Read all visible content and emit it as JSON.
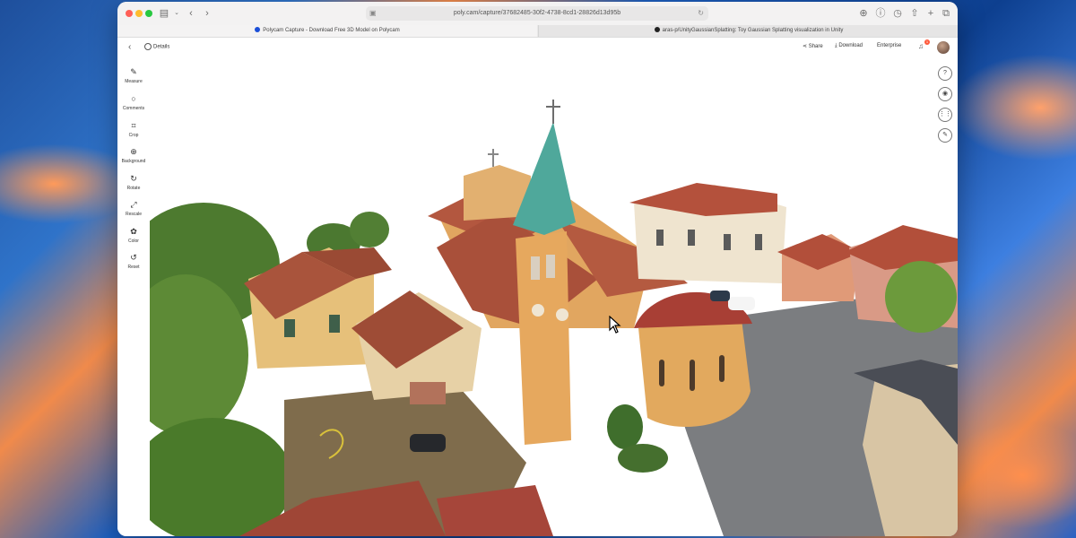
{
  "browser": {
    "url": "poly.cam/capture/37682485-30f2-4738-8cd1-28826d13d95b",
    "tabs": [
      {
        "label": "Polycam Capture - Download Free 3D Model on Polycam",
        "active": true
      },
      {
        "label": "aras-p/UnityGaussianSplatting: Toy Gaussian Splatting visualization in Unity",
        "active": false
      }
    ],
    "icons": [
      "sidebar-icon",
      "chevron-down-icon",
      "back-icon",
      "forward-icon",
      "download-icon",
      "info-icon",
      "history-icon",
      "share-icon",
      "new-tab-icon",
      "tab-overview-icon"
    ]
  },
  "header": {
    "details_label": "Details",
    "share_label": "Share",
    "download_label": "Download",
    "enterprise_label": "Enterprise",
    "notification_count": "1"
  },
  "sidebar": {
    "tools": [
      {
        "label": "Measure",
        "icon": "ruler-icon"
      },
      {
        "label": "Comments",
        "icon": "comment-icon"
      },
      {
        "label": "Crop",
        "icon": "crop-icon"
      },
      {
        "label": "Background",
        "icon": "globe-icon"
      },
      {
        "label": "Rotate",
        "icon": "rotate-icon"
      },
      {
        "label": "Rescale",
        "icon": "rescale-icon"
      },
      {
        "label": "Color",
        "icon": "color-icon"
      },
      {
        "label": "Reset",
        "icon": "reset-icon"
      }
    ]
  },
  "right_tools": [
    {
      "icon": "help-icon",
      "glyph": "?"
    },
    {
      "icon": "camera-icon",
      "glyph": "◉"
    },
    {
      "icon": "grid-icon",
      "glyph": "⋮⋮"
    },
    {
      "icon": "wand-icon",
      "glyph": "✎"
    }
  ],
  "colors": {
    "accent": "#1b4fd8",
    "notification": "#ff5a3c",
    "roof": "#b4513c",
    "spire": "#4fa89b",
    "wall": "#e0a45c"
  }
}
